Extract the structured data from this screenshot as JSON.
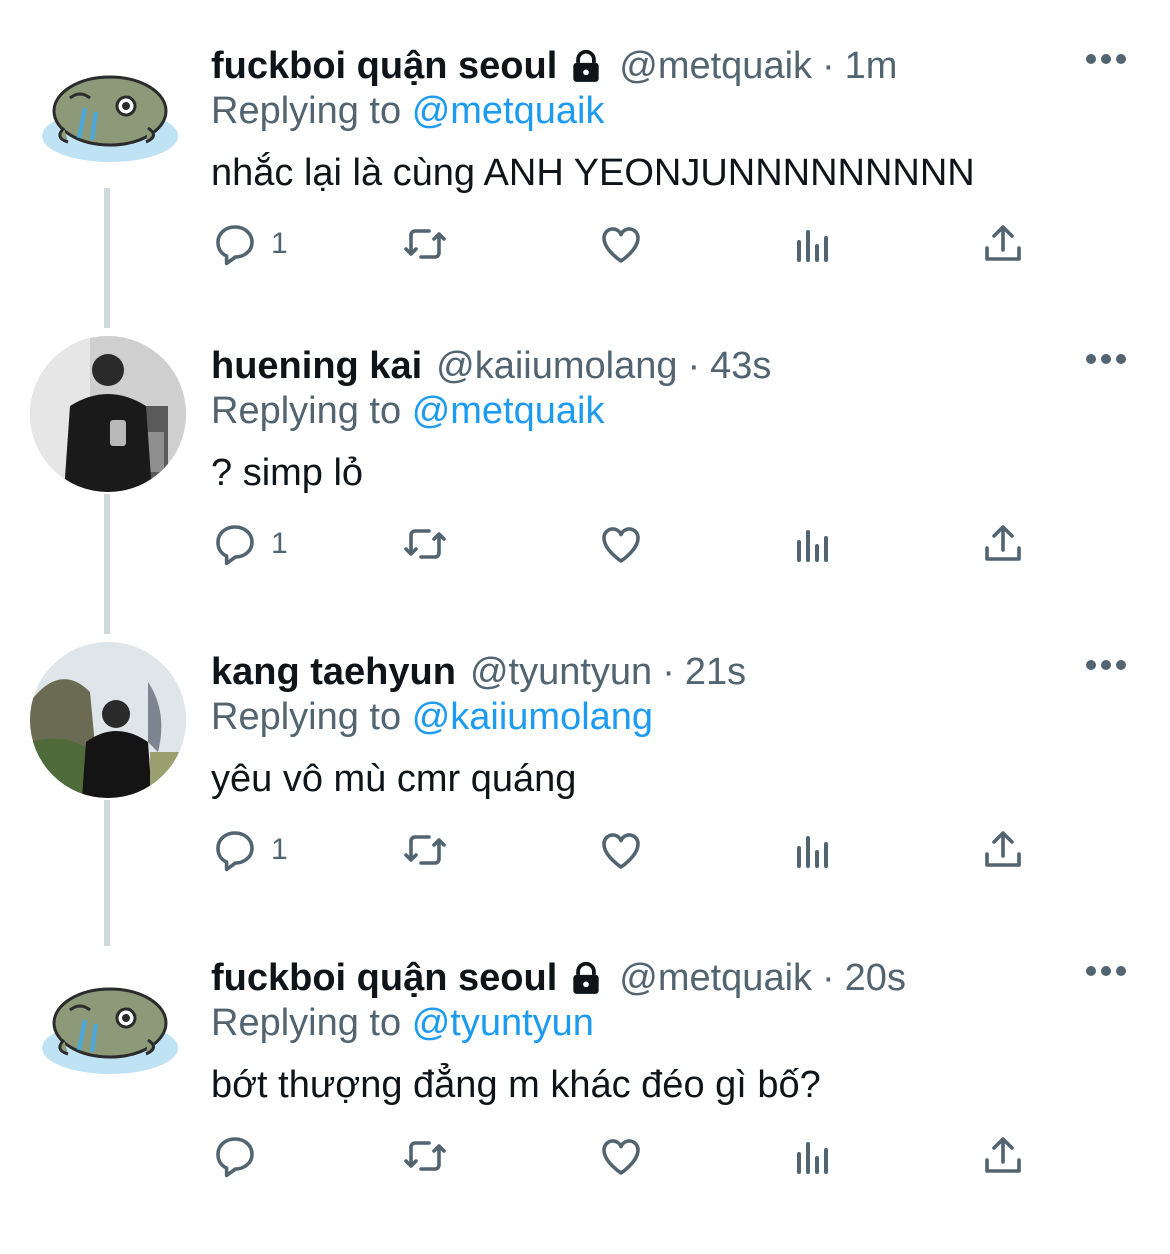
{
  "tweets": [
    {
      "display_name": "fuckboi quận seoul",
      "locked": true,
      "handle": "@metquaik",
      "separator": "·",
      "time": "1m",
      "replying_prefix": "Replying to",
      "replying_to": "@metquaik",
      "text": "nhắc lại là cùng ANH YEONJUNNNNNNNNN",
      "reply_count": "1",
      "avatar": "cartoon-seal-avatar"
    },
    {
      "display_name": "huening kai",
      "locked": false,
      "handle": "@kaiiumolang",
      "separator": "·",
      "time": "43s",
      "replying_prefix": "Replying to",
      "replying_to": "@metquaik",
      "text": "? simp lỏ",
      "reply_count": "1",
      "avatar": "mirror-selfie-photo-avatar"
    },
    {
      "display_name": "kang taehyun",
      "locked": false,
      "handle": "@tyuntyun",
      "separator": "·",
      "time": "21s",
      "replying_prefix": "Replying to",
      "replying_to": "@kaiiumolang",
      "text": "yêu vô mù cmr quáng",
      "reply_count": "1",
      "avatar": "outdoor-photo-avatar"
    },
    {
      "display_name": "fuckboi quận seoul",
      "locked": true,
      "handle": "@metquaik",
      "separator": "·",
      "time": "20s",
      "replying_prefix": "Replying to",
      "replying_to": "@tyuntyun",
      "text": "bớt thượng đẳng m khác đéo gì bố?",
      "reply_count": "",
      "avatar": "cartoon-seal-avatar"
    }
  ],
  "icons": [
    "reply-icon",
    "retweet-icon",
    "like-icon",
    "analytics-icon",
    "share-icon",
    "more-icon",
    "lock-icon"
  ],
  "colors": {
    "text": "#0f1419",
    "secondary": "#536471",
    "link": "#1d9bf0",
    "thread_line": "#cfd9de"
  }
}
